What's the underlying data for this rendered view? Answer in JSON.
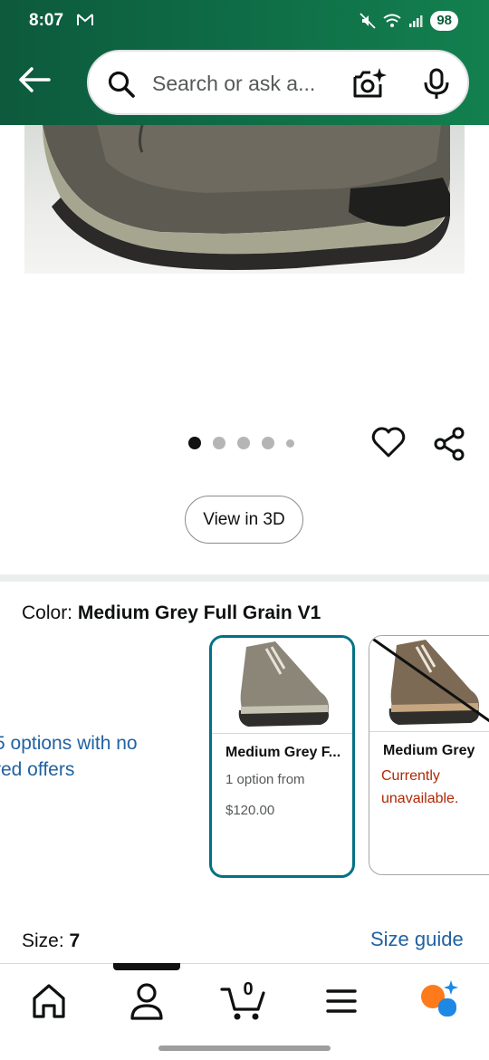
{
  "status_bar": {
    "time": "8:07",
    "battery": "98"
  },
  "search": {
    "placeholder": "Search or ask a..."
  },
  "carousel": {
    "dot_count": 5,
    "active_index": 0
  },
  "view_3d_label": "View in 3D",
  "color": {
    "label": "Color: ",
    "value": "Medium Grey Full Grain V1"
  },
  "options_link": {
    "line1": "5 options with no",
    "line2": "red offers"
  },
  "swatches": [
    {
      "title": "Medium Grey F...",
      "subtitle": "1 option from",
      "price": "$120.00",
      "selected": true
    },
    {
      "title": "Medium Grey",
      "status": "Currently unavailable.",
      "selected": false
    }
  ],
  "size": {
    "label": "Size: ",
    "value": "7",
    "guide_label": "Size guide"
  },
  "bottom_nav": {
    "items": [
      "home-icon",
      "account-icon",
      "cart-icon",
      "menu-icon",
      "assistant-icon"
    ],
    "cart_count": "0"
  },
  "colors": {
    "header_green": "#0e6b45",
    "accent_teal": "#007185",
    "link_blue": "#2162a1",
    "unavailable_red": "#b12704",
    "assistant_orange": "#ff7a1a",
    "assistant_blue": "#1e88e5"
  }
}
